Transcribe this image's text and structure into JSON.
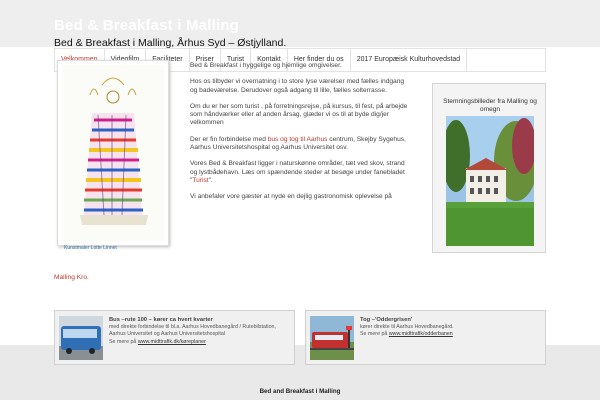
{
  "header": {
    "site_title": "Bed & Breakfast i Malling"
  },
  "nav": {
    "items": [
      {
        "label": "Velkommen",
        "active": true
      },
      {
        "label": "Videofilm"
      },
      {
        "label": "Faciliteter"
      },
      {
        "label": "Priser"
      },
      {
        "label": "Turist"
      },
      {
        "label": "Kontakt"
      },
      {
        "label": "Her finder du os"
      },
      {
        "label": "2017 Europæisk Kulturhovedstad"
      }
    ]
  },
  "main": {
    "heading": "Bed & Breakfast i Malling, Århus Syd – Østjylland.",
    "art_caption": "Kunstmaler Lotte Linnet",
    "p1": "Bed & Breakfast i hyggelige og hjemlige omgivelser.",
    "p2": "Hos os tilbyder vi overnatning i to store lyse værelser med fælles indgang og  badeværelse. Derudover også adgang til lille, fælles solterrasse.",
    "p3": "Om du er her som turist , på forretningsrejse, på kursus, til fest, på arbejde som håndværker eller af anden årsag, glæder vi os til at byde dig/jer velkommen",
    "p4_pre": "Der er fin forbindelse med ",
    "p4_link": "bus og tog til Aarhus",
    "p4_post": " centrum, Skejby Sygehus, Aarhus Universitetshospital og Aarhus Universitet osv.",
    "p5_pre": "Vores Bed & Breakfast ligger i naturskønne områder, tæt ved skov, strand og lystbådehavn. Læs om spændende steder at besøge under fanebladet \"",
    "p5_link": "Turist",
    "p5_post": "\".",
    "p6": "Vi anbefaler vore gæster at nyde en dejlig  gastronomisk oplevelse på",
    "p6_link": "Malling Kro."
  },
  "side": {
    "title": "Stemningsbilleder fra Malling og omegn"
  },
  "bus": {
    "title": "Bus –rute 100  – kører ca hvert kvarter",
    "line1": "med direkte forbindelse til bl.a. Aarhus Hovedbanegård / Rutebilstation, Aarhus Universitet og Aarhus Universitetshospital",
    "more": "Se mere på ",
    "link": "www.midttrafik.dk/køreplaner"
  },
  "train": {
    "title": "Tog –'Oddergrisen'",
    "line1": "kører direkte til Aarhus Hovedbanegård.",
    "more": "Se mere på ",
    "link": "www.midttrafik/odderbanen"
  },
  "footer": {
    "text": "Bed and Breakfast i Malling"
  },
  "colors": {
    "accent": "#c0392b",
    "header_bg": "#eeeeee",
    "page_bg": "#ffffff"
  }
}
